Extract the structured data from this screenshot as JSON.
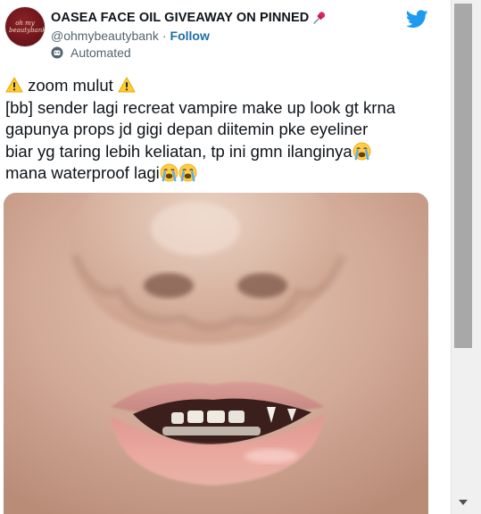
{
  "tweet": {
    "author": {
      "avatar_text": "oh my beautybank",
      "display_name": "OASEA FACE OIL GIVEAWAY ON PINNED",
      "handle": "@ohmybeautybank",
      "separator": "·",
      "follow_label": "Follow",
      "automated_label": "Automated"
    },
    "icons": {
      "pin": "pushpin-icon",
      "bot": "robot-icon",
      "brand": "twitter-bird-icon",
      "warning": "warning-icon",
      "crying": "crying-face-icon"
    },
    "text_lines": [
      "zoom mulut",
      "[bb] sender lagi recreat vampire make up look gt krna",
      "gapunya props jd gigi depan diitemin pke eyeliner",
      "biar yg taring lebih keliatan, tp ini gmn ilanginya",
      "mana waterproof lagi"
    ]
  },
  "colors": {
    "brand_blue": "#1d9bf0",
    "follow_blue": "#1d6fa5",
    "secondary_text": "#536471",
    "avatar_bg": "#6a1419"
  }
}
